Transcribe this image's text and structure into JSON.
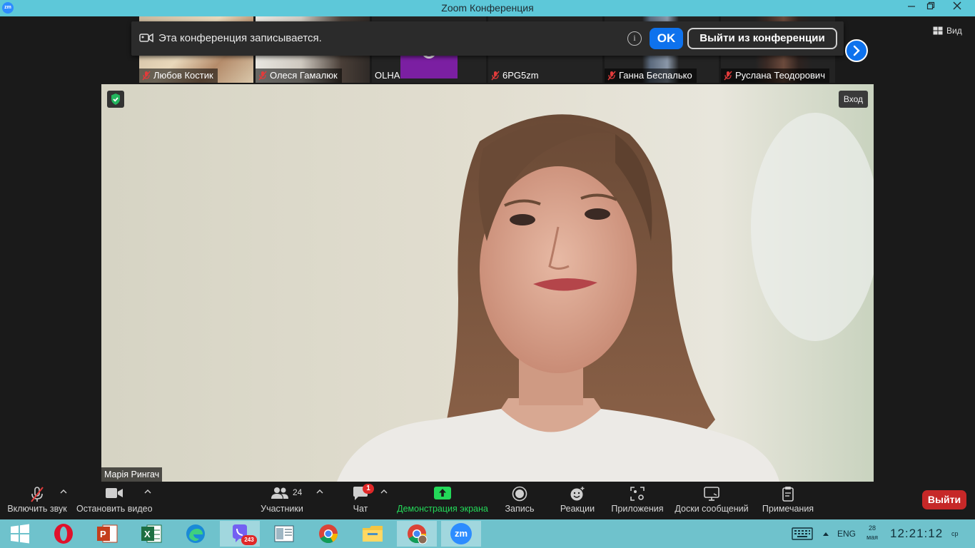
{
  "window": {
    "title": "Zoom Конференция",
    "app_icon_label": "zm"
  },
  "banner": {
    "message": "Эта конференция записывается.",
    "info_label": "i",
    "ok_label": "OK",
    "leave_label": "Выйти из конференции"
  },
  "view_label": "Вид",
  "participants": [
    {
      "name": "Любов Костик",
      "muted": true
    },
    {
      "name": "Олеся Гамалюк",
      "muted": true
    },
    {
      "name": "OLHA",
      "muted": false
    },
    {
      "name": "6PG5zm",
      "muted": true
    },
    {
      "name": "Ганна Беспалько",
      "muted": true
    },
    {
      "name": "Руслана Теодорович",
      "muted": true
    }
  ],
  "main": {
    "speaker_name": "Марія Рингач",
    "enter_label": "Вход"
  },
  "toolbar": {
    "audio_label": "Включить звук",
    "video_label": "Остановить видео",
    "participants_label": "Участники",
    "participants_count": "24",
    "chat_label": "Чат",
    "chat_badge": "1",
    "share_label": "Демонстрация экрана",
    "record_label": "Запись",
    "reactions_label": "Реакции",
    "apps_label": "Приложения",
    "whiteboards_label": "Доски сообщений",
    "notes_label": "Примечания",
    "exit_label": "Выйти"
  },
  "taskbar": {
    "viber_badge": "243",
    "zoom_label": "zm",
    "lang": "ENG",
    "date_top": "28",
    "date_bottom": "мая",
    "time": "12:21:12",
    "day": "ср"
  },
  "colors": {
    "accent": "#0e72ed",
    "share_green": "#23d959",
    "exit_red": "#c62828",
    "titlebar": "#5dc8d9",
    "taskbar": "#6fc2cc"
  }
}
